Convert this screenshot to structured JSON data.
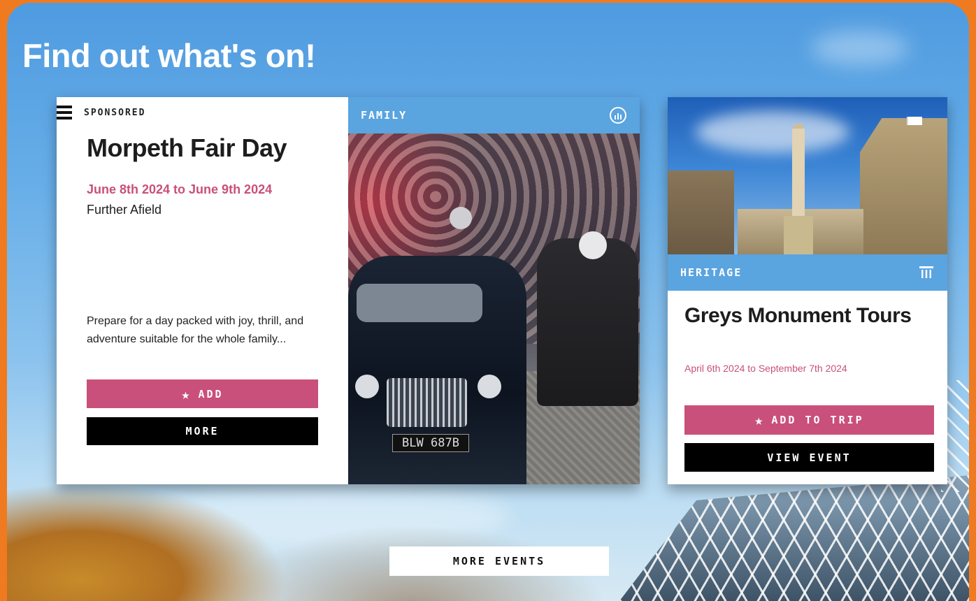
{
  "page": {
    "title": "Find out what's on!",
    "more_events_label": "MORE EVENTS"
  },
  "featured_event": {
    "badge": "SPONSORED",
    "title": "Morpeth Fair Day",
    "dates": "June 8th 2024 to June 9th 2024",
    "location": "Further Afield",
    "description": "Prepare for a day packed with joy, thrill, and adventure suitable for the whole family...",
    "category": "FAMILY",
    "category_icon": "family-category-icon",
    "add_label": "ADD",
    "more_label": "MORE",
    "photo_plate_text": "BLW 687B"
  },
  "side_event": {
    "category": "HERITAGE",
    "category_icon": "column-icon",
    "title": "Greys Monument Tours",
    "dates": "April 6th 2024 to September 7th 2024",
    "add_label": "ADD TO TRIP",
    "view_label": "VIEW EVENT"
  },
  "colors": {
    "accent_pink": "#c9507a",
    "category_blue": "#5aa4e0",
    "frame_orange": "#f07a1f",
    "button_black": "#000000"
  }
}
